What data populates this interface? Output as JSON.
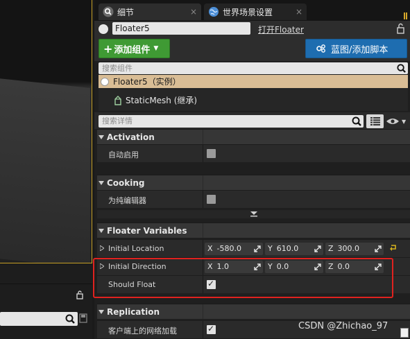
{
  "tabs": [
    {
      "label": "细节",
      "icon": "magnifier-icon"
    },
    {
      "label": "世界场景设置",
      "icon": "globe-icon"
    }
  ],
  "actor": {
    "name": "Floater5",
    "open_link": "打开Floater"
  },
  "toolbar": {
    "add_component": "添加组件",
    "blueprint": "蓝图/添加脚本"
  },
  "component_search": {
    "placeholder": "搜索组件"
  },
  "component_tree": {
    "root": "Floater5（实例）",
    "child": "StaticMesh (继承)"
  },
  "details_search": {
    "placeholder": "搜索详情"
  },
  "categories": {
    "activation": {
      "title": "Activation",
      "rows": [
        {
          "label": "自动启用",
          "checked": false
        }
      ]
    },
    "cooking": {
      "title": "Cooking",
      "rows": [
        {
          "label": "为纯编辑器",
          "checked": false
        }
      ]
    },
    "floater_variables": {
      "title": "Floater Variables",
      "initial_location": {
        "label": "Initial Location",
        "x": {
          "axis": "X",
          "value": "-580.0"
        },
        "y": {
          "axis": "Y",
          "value": "610.0"
        },
        "z": {
          "axis": "Z",
          "value": "300.0"
        }
      },
      "initial_direction": {
        "label": "Initial Direction",
        "x": {
          "axis": "X",
          "value": "1.0"
        },
        "y": {
          "axis": "Y",
          "value": "0.0"
        },
        "z": {
          "axis": "Z",
          "value": "0.0"
        }
      },
      "should_float": {
        "label": "Should Float",
        "checked": true
      }
    },
    "replication": {
      "title": "Replication",
      "rows": [
        {
          "label": "客户端上的网络加载",
          "checked": true
        }
      ]
    }
  },
  "watermark": "CSDN @Zhichao_97",
  "colors": {
    "add_button": "#3f9a34",
    "blueprint_button": "#1e6db0",
    "selected_component": "#d9bd95",
    "highlight": "#e0221f"
  }
}
